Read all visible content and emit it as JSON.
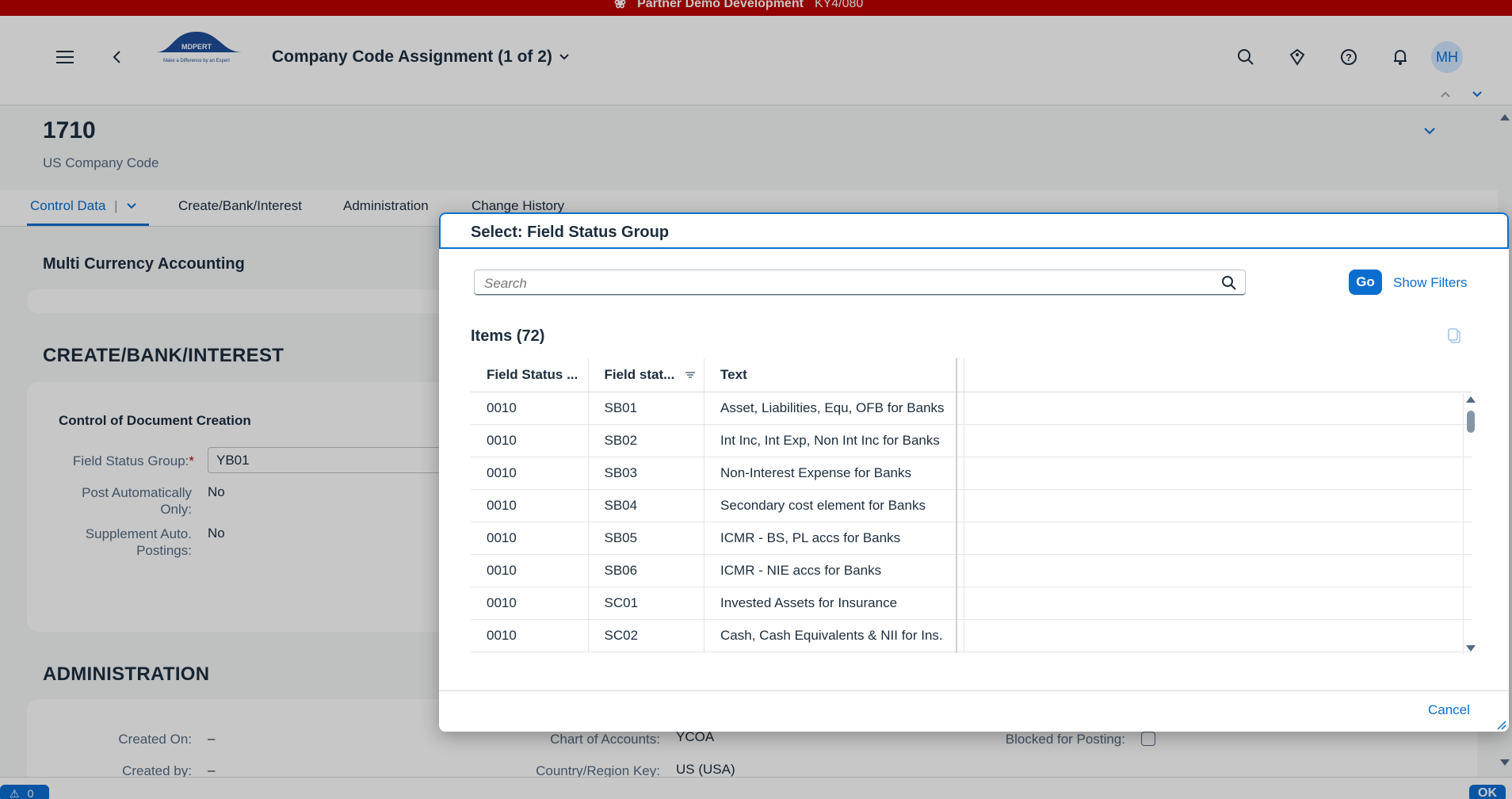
{
  "system_bar": {
    "title": "Partner Demo Development",
    "system_id": "KY4/080"
  },
  "shell": {
    "logo_text": "MDPERT",
    "logo_tagline": "Make a Difference by an Expert",
    "app_title": "Company Code Assignment (1 of 2)",
    "avatar_initials": "MH"
  },
  "object": {
    "title": "1710",
    "subtitle": "US Company Code"
  },
  "tabs": [
    {
      "label": "Control Data",
      "active": true
    },
    {
      "label": "Create/Bank/Interest"
    },
    {
      "label": "Administration"
    },
    {
      "label": "Change History"
    }
  ],
  "sections": {
    "multi_currency": "Multi Currency Accounting",
    "create_bank": "CREATE/BANK/INTEREST",
    "doc_creation": "Control of Document Creation",
    "administration": "ADMINISTRATION"
  },
  "fields": {
    "field_status_group": {
      "label": "Field Status Group:",
      "required_mark": "*",
      "value": "YB01"
    },
    "post_auto": {
      "label_1": "Post Automatically",
      "label_2": "Only:",
      "value": "No"
    },
    "supplement": {
      "label_1": "Supplement Auto.",
      "label_2": "Postings:",
      "value": "No"
    },
    "created_on": {
      "label": "Created On:",
      "value": "–"
    },
    "created_by": {
      "label": "Created by:",
      "value": "–"
    },
    "chart_of_accounts": {
      "label": "Chart of Accounts:",
      "value": "YCOA"
    },
    "country": {
      "label": "Country/Region Key:",
      "value": "US (USA)"
    },
    "blocked": {
      "label": "Blocked for Posting:",
      "checked": false
    }
  },
  "dialog": {
    "title": "Select: Field Status Group",
    "search_placeholder": "Search",
    "go_label": "Go",
    "show_filters_label": "Show Filters",
    "items_title": "Items (72)",
    "columns": [
      "Field Status ...",
      "Field stat...",
      "Text"
    ],
    "rows": [
      {
        "variant": "0010",
        "group": "SB01",
        "text": "Asset, Liabilities, Equ, OFB for Banks"
      },
      {
        "variant": "0010",
        "group": "SB02",
        "text": "Int Inc, Int Exp, Non Int Inc for Banks"
      },
      {
        "variant": "0010",
        "group": "SB03",
        "text": "Non-Interest Expense for Banks"
      },
      {
        "variant": "0010",
        "group": "SB04",
        "text": "Secondary cost element for Banks"
      },
      {
        "variant": "0010",
        "group": "SB05",
        "text": "ICMR - BS, PL accs for Banks"
      },
      {
        "variant": "0010",
        "group": "SB06",
        "text": "ICMR - NIE accs for Banks"
      },
      {
        "variant": "0010",
        "group": "SC01",
        "text": "Invested Assets for Insurance"
      },
      {
        "variant": "0010",
        "group": "SC02",
        "text": "Cash, Cash Equivalents & NII for Ins."
      }
    ],
    "cancel_label": "Cancel"
  },
  "footer": {
    "message_count": "0",
    "ok_label": "OK"
  },
  "colors": {
    "accent": "#0a6ed1",
    "system_bar": "#bb0000"
  }
}
